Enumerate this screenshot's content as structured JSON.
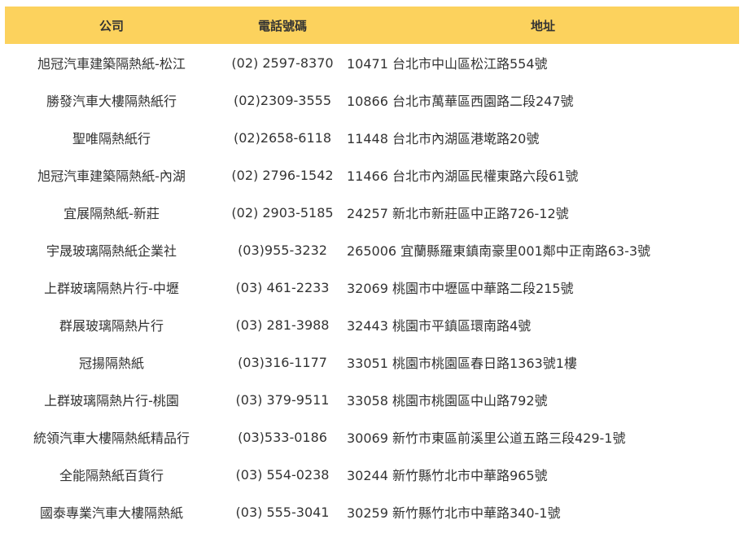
{
  "table": {
    "headers": {
      "name": "公司",
      "phone": "電話號碼",
      "address": "地址"
    },
    "rows": [
      {
        "name": "旭冠汽車建築隔熱紙-松江",
        "phone": "(02) 2597-8370",
        "address": "10471 台北市中山區松江路554號"
      },
      {
        "name": "勝發汽車大樓隔熱紙行",
        "phone": "(02)2309-3555",
        "address": "10866 台北市萬華區西園路二段247號"
      },
      {
        "name": "聖唯隔熱紙行",
        "phone": "(02)2658-6118",
        "address": "11448 台北市內湖區港墘路20號"
      },
      {
        "name": "旭冠汽車建築隔熱紙-內湖",
        "phone": "(02) 2796-1542",
        "address": "11466 台北市內湖區民權東路六段61號"
      },
      {
        "name": "宜展隔熱紙-新莊",
        "phone": "(02) 2903-5185",
        "address": "24257 新北市新莊區中正路726-12號"
      },
      {
        "name": "宇晟玻璃隔熱紙企業社",
        "phone": "(03)955-3232",
        "address": "265006 宜蘭縣羅東鎮南豪里001鄰中正南路63-3號"
      },
      {
        "name": "上群玻璃隔熱片行-中壢",
        "phone": "(03) 461-2233",
        "address": "32069 桃園市中壢區中華路二段215號"
      },
      {
        "name": "群展玻璃隔熱片行",
        "phone": "(03) 281-3988",
        "address": "32443 桃園市平鎮區環南路4號"
      },
      {
        "name": "冠揚隔熱紙",
        "phone": "(03)316-1177",
        "address": "33051 桃園市桃園區春日路1363號1樓"
      },
      {
        "name": "上群玻璃隔熱片行-桃園",
        "phone": "(03) 379-9511",
        "address": "33058 桃園市桃園區中山路792號"
      },
      {
        "name": "統領汽車大樓隔熱紙精品行",
        "phone": "(03)533-0186",
        "address": "30069 新竹市東區前溪里公道五路三段429-1號"
      },
      {
        "name": "全能隔熱紙百貨行",
        "phone": "(03) 554-0238",
        "address": "30244 新竹縣竹北市中華路965號"
      },
      {
        "name": "國泰專業汽車大樓隔熱紙",
        "phone": "(03) 555-3041",
        "address": "30259 新竹縣竹北市中華路340-1號"
      }
    ]
  },
  "colors": {
    "header_bg": "#fcd25d",
    "text": "#333333",
    "page_bg": "#ffffff"
  }
}
